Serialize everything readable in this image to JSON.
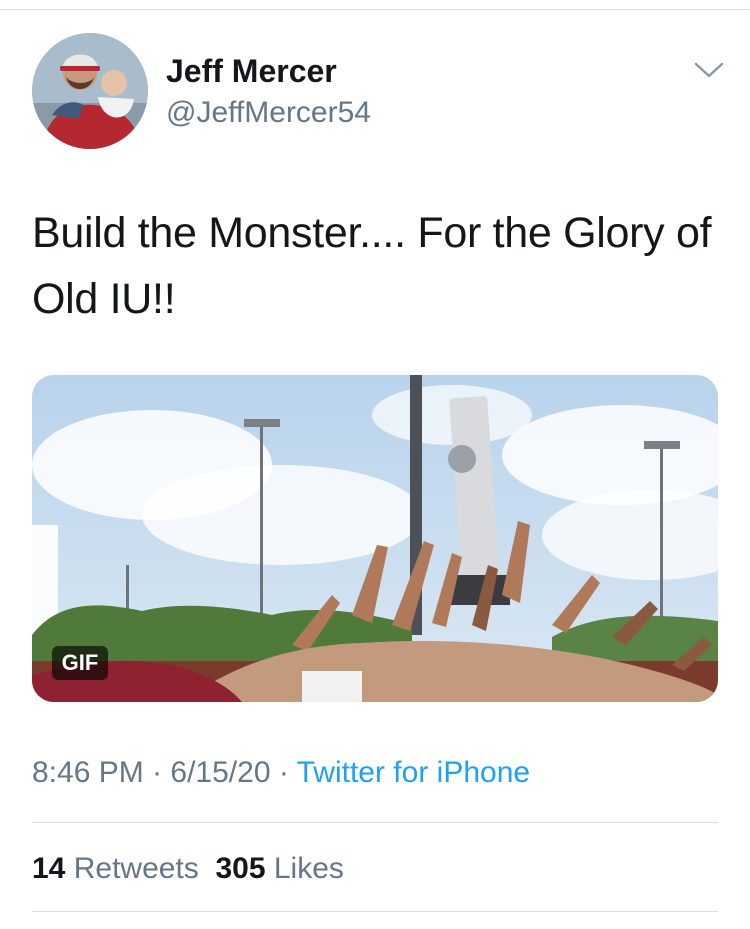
{
  "author": {
    "display_name": "Jeff Mercer",
    "handle": "@JeffMercer54"
  },
  "icons": {
    "menu": "chevron-down-icon",
    "avatar": "profile-photo"
  },
  "tweet": {
    "text": "Build the Monster.... For the Glory of Old IU!!",
    "media_badge": "GIF"
  },
  "meta": {
    "time": "8:46 PM",
    "separator": " · ",
    "date": "6/15/20",
    "source": "Twitter for iPhone"
  },
  "stats": {
    "retweets_count": "14",
    "retweets_label": "Retweets",
    "likes_count": "305",
    "likes_label": "Likes"
  },
  "colors": {
    "link": "#1da1f2",
    "secondary_text": "#657786",
    "primary_text": "#14171a",
    "divider": "#d9dde1"
  }
}
